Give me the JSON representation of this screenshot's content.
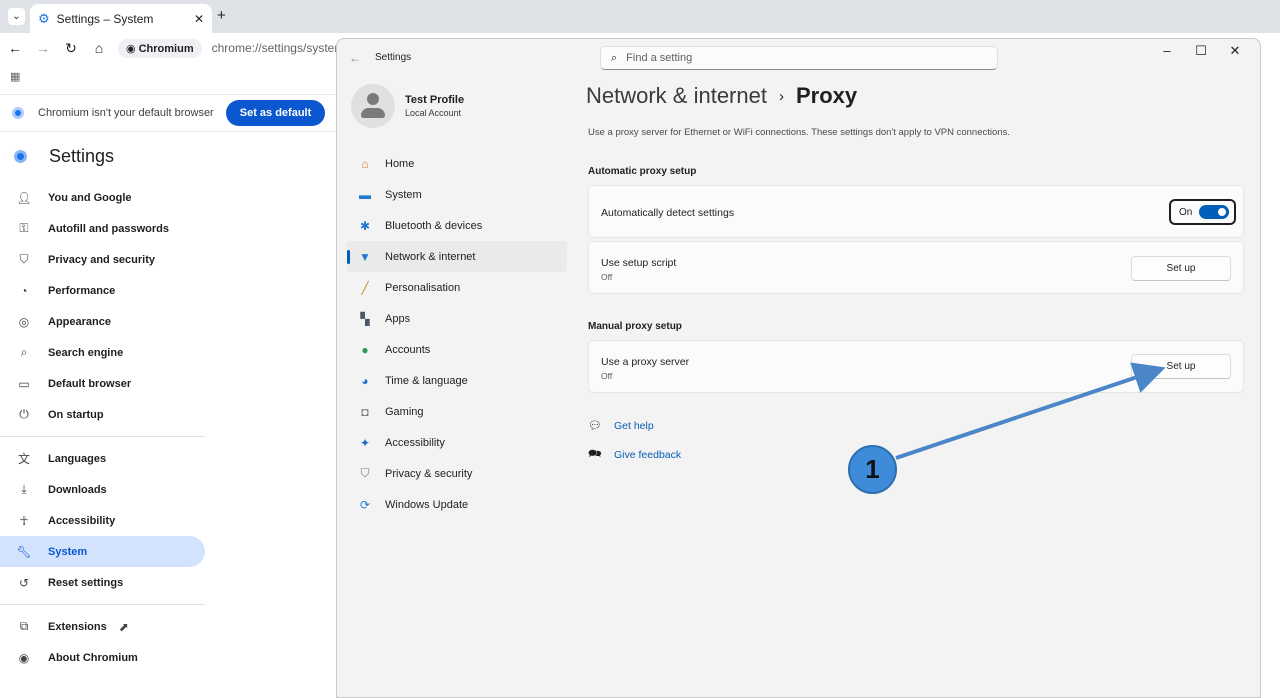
{
  "browser": {
    "tab_title": "Settings – System",
    "chip_label": "Chromium",
    "url": "chrome://settings/system",
    "infobar_text": "Chromium isn't your default browser",
    "default_button": "Set as default"
  },
  "chromium_settings": {
    "title": "Settings",
    "nav_group1": [
      {
        "label": "You and Google",
        "icon": "person-icon"
      },
      {
        "label": "Autofill and passwords",
        "icon": "key-icon"
      },
      {
        "label": "Privacy and security",
        "icon": "shield-icon"
      },
      {
        "label": "Performance",
        "icon": "gauge-icon"
      },
      {
        "label": "Appearance",
        "icon": "palette-icon"
      },
      {
        "label": "Search engine",
        "icon": "search-icon"
      },
      {
        "label": "Default browser",
        "icon": "browser-icon"
      },
      {
        "label": "On startup",
        "icon": "power-icon"
      }
    ],
    "nav_group2": [
      {
        "label": "Languages",
        "icon": "translate-icon"
      },
      {
        "label": "Downloads",
        "icon": "download-icon"
      },
      {
        "label": "Accessibility",
        "icon": "accessibility-icon"
      },
      {
        "label": "System",
        "icon": "wrench-icon"
      },
      {
        "label": "Reset settings",
        "icon": "reset-icon"
      }
    ],
    "nav_group3": [
      {
        "label": "Extensions",
        "icon": "puzzle-icon"
      },
      {
        "label": "About Chromium",
        "icon": "chromium-icon"
      }
    ],
    "active_item": "System"
  },
  "windows_settings": {
    "window_title": "Settings",
    "search_placeholder": "Find a setting",
    "profile": {
      "name": "Test Profile",
      "subtitle": "Local Account"
    },
    "nav": [
      {
        "label": "Home",
        "icon": "home-icon"
      },
      {
        "label": "System",
        "icon": "monitor-icon"
      },
      {
        "label": "Bluetooth & devices",
        "icon": "bluetooth-icon"
      },
      {
        "label": "Network & internet",
        "icon": "wifi-icon"
      },
      {
        "label": "Personalisation",
        "icon": "brush-icon"
      },
      {
        "label": "Apps",
        "icon": "apps-icon"
      },
      {
        "label": "Accounts",
        "icon": "account-icon"
      },
      {
        "label": "Time & language",
        "icon": "globe-clock-icon"
      },
      {
        "label": "Gaming",
        "icon": "gamepad-icon"
      },
      {
        "label": "Accessibility",
        "icon": "accessibility-icon"
      },
      {
        "label": "Privacy & security",
        "icon": "shield-icon"
      },
      {
        "label": "Windows Update",
        "icon": "update-icon"
      }
    ],
    "active_nav": "Network & internet",
    "breadcrumb": {
      "parent": "Network & internet",
      "current": "Proxy"
    },
    "description": "Use a proxy server for Ethernet or WiFi connections. These settings don't apply to VPN connections.",
    "automatic": {
      "section_title": "Automatic proxy setup",
      "detect_label": "Automatically detect settings",
      "detect_state": "On",
      "script_label": "Use setup script",
      "script_state": "Off",
      "script_button": "Set up"
    },
    "manual": {
      "section_title": "Manual proxy setup",
      "proxy_label": "Use a proxy server",
      "proxy_state": "Off",
      "proxy_button": "Set up"
    },
    "links": {
      "help": "Get help",
      "feedback": "Give feedback"
    }
  },
  "annotation": {
    "number": "1",
    "color": "#3d8bd9"
  }
}
